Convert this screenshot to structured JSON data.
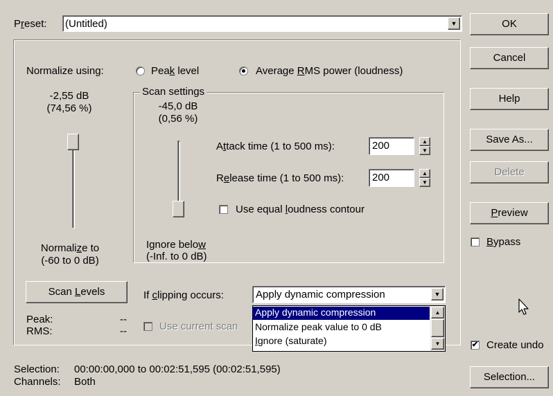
{
  "preset": {
    "label": "Preset:",
    "value": "(Untitled)"
  },
  "normalize": {
    "label": "Normalize using:",
    "peak_level": "Peak level",
    "average_rms": "Average RMS power (loudness)",
    "selected": "average_rms",
    "db_value": "-2,55 dB",
    "pct_value": "(74,56 %)",
    "slider_caption_1": "Normalize to",
    "slider_caption_2": "(-60 to 0 dB)",
    "slider_level": 0.96
  },
  "scan_settings": {
    "title": "Scan settings",
    "db_value": "-45,0 dB",
    "pct_value": "(0,56 %)",
    "ignore_caption_1": "Ignore below",
    "ignore_caption_2": "(-Inf. to 0 dB)",
    "slider_level": 0.25,
    "attack_label": "Attack time (1 to 500 ms):",
    "attack_value": "200",
    "release_label": "Release time (1 to 500 ms):",
    "release_value": "200",
    "equal_loudness_label": "Use equal loudness contour",
    "equal_loudness_checked": false
  },
  "scan_levels": {
    "button": "Scan Levels",
    "peak_label": "Peak:",
    "peak_value": "--",
    "rms_label": "RMS:",
    "rms_value": "--"
  },
  "clipping": {
    "label": "If clipping occurs:",
    "selected": "Apply dynamic compression",
    "options": [
      "Apply dynamic compression",
      "Normalize peak value to 0 dB",
      "Ignore (saturate)"
    ],
    "use_current_label": "Use current scan"
  },
  "buttons": {
    "ok": "OK",
    "cancel": "Cancel",
    "help": "Help",
    "save_as": "Save As...",
    "delete": "Delete",
    "preview": "Preview",
    "selection": "Selection..."
  },
  "bypass": {
    "label": "Bypass",
    "checked": false
  },
  "create_undo": {
    "label": "Create undo",
    "checked": true
  },
  "status": {
    "selection_label": "Selection:",
    "selection_value": "00:00:00,000 to 00:02:51,595 (00:02:51,595)",
    "channels_label": "Channels:",
    "channels_value": "Both"
  },
  "icons": {
    "dropdown": "chevron-down-icon",
    "cursor": "mouse-pointer-icon"
  },
  "colors": {
    "face": "#d4d0c8",
    "highlight": "#000080"
  }
}
